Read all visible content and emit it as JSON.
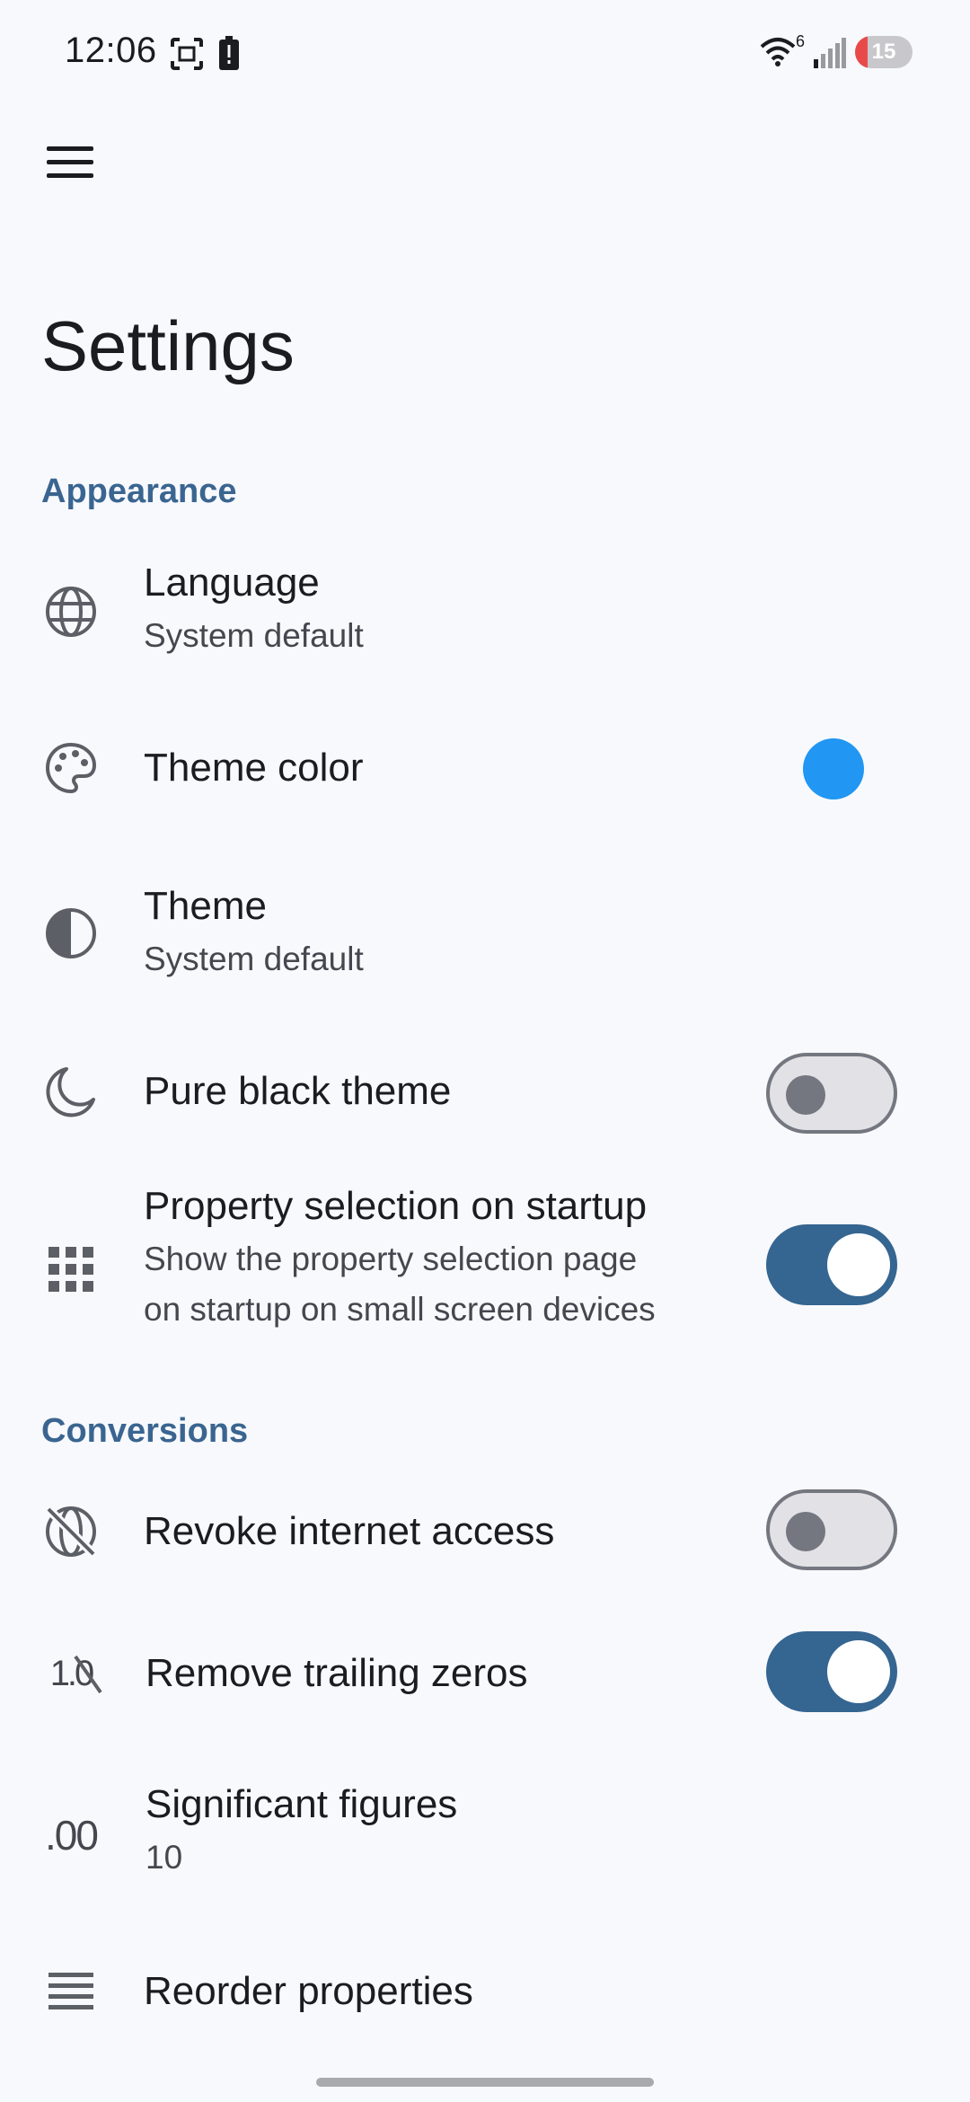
{
  "status_bar": {
    "time": "12:06",
    "wifi_badge": "6",
    "battery_level": "15",
    "icons": [
      "screenshot-icon",
      "alert-battery-icon",
      "wifi-icon",
      "signal-icon",
      "battery-icon"
    ]
  },
  "header": {
    "menu_icon": "hamburger-menu-icon",
    "title": "Settings"
  },
  "appearance": {
    "header": "Appearance",
    "language": {
      "title": "Language",
      "subtitle": "System default",
      "icon": "globe-icon"
    },
    "theme_color": {
      "title": "Theme color",
      "icon": "palette-icon",
      "color": "#2196f3"
    },
    "theme": {
      "title": "Theme",
      "subtitle": "System default",
      "icon": "contrast-icon"
    },
    "pure_black": {
      "title": "Pure black theme",
      "icon": "moon-icon",
      "enabled": false
    },
    "property_selection": {
      "title": "Property selection on startup",
      "subtitle_line1": "Show the property selection page",
      "subtitle_line2": "on startup on small screen devices",
      "icon": "grid-icon",
      "enabled": true
    }
  },
  "conversions": {
    "header": "Conversions",
    "revoke_internet": {
      "title": "Revoke internet access",
      "icon": "no-internet-icon",
      "enabled": false
    },
    "trailing_zeros": {
      "title": "Remove trailing zeros",
      "icon": "trailing-zeros-icon",
      "icon_text": "1.0",
      "enabled": true
    },
    "significant_figures": {
      "title": "Significant figures",
      "value": "10",
      "icon": "decimal-icon",
      "icon_text": ".00"
    },
    "reorder_properties": {
      "title": "Reorder properties",
      "icon": "reorder-icon"
    }
  },
  "colors": {
    "accent": "#3a6590",
    "switch_on": "#356591",
    "theme_dot": "#2196f3",
    "background": "#f8f9fd"
  }
}
